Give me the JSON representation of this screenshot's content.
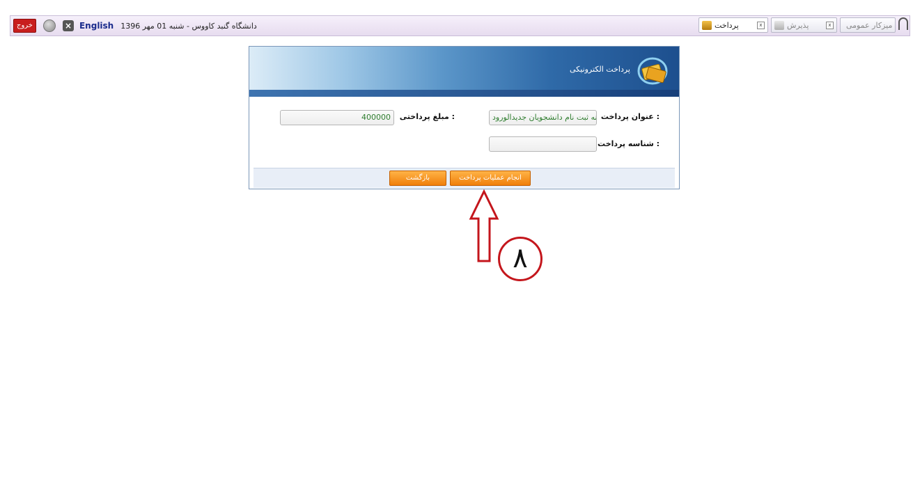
{
  "topbar": {
    "exit_label": "خروج",
    "language_label": "English",
    "date_info": "دانشگاه گنبد کاووس - شنبه 01 مهر 1396",
    "tabs": [
      {
        "label": "میزکار عمومی"
      },
      {
        "label": "پذیرش"
      },
      {
        "label": "پرداخت"
      }
    ]
  },
  "panel": {
    "banner_title": "پرداخت الکترونیکی",
    "payment_title_label": "عنوان پرداخت :",
    "payment_title_value": "هزینه ثبت نام دانشجویان جدیدالورود",
    "payment_id_label": "شناسه پرداخت :",
    "payment_id_value": "",
    "amount_label": "مبلغ پرداختی :",
    "amount_value": "400000",
    "pay_button": "انجام عملیات پرداخت",
    "back_button": "بازگشت"
  },
  "annotation": {
    "number": "٨"
  },
  "colors": {
    "accent_orange": "#f07f0a",
    "annotation_red": "#c4161c",
    "field_text_green": "#2e7d2e"
  }
}
